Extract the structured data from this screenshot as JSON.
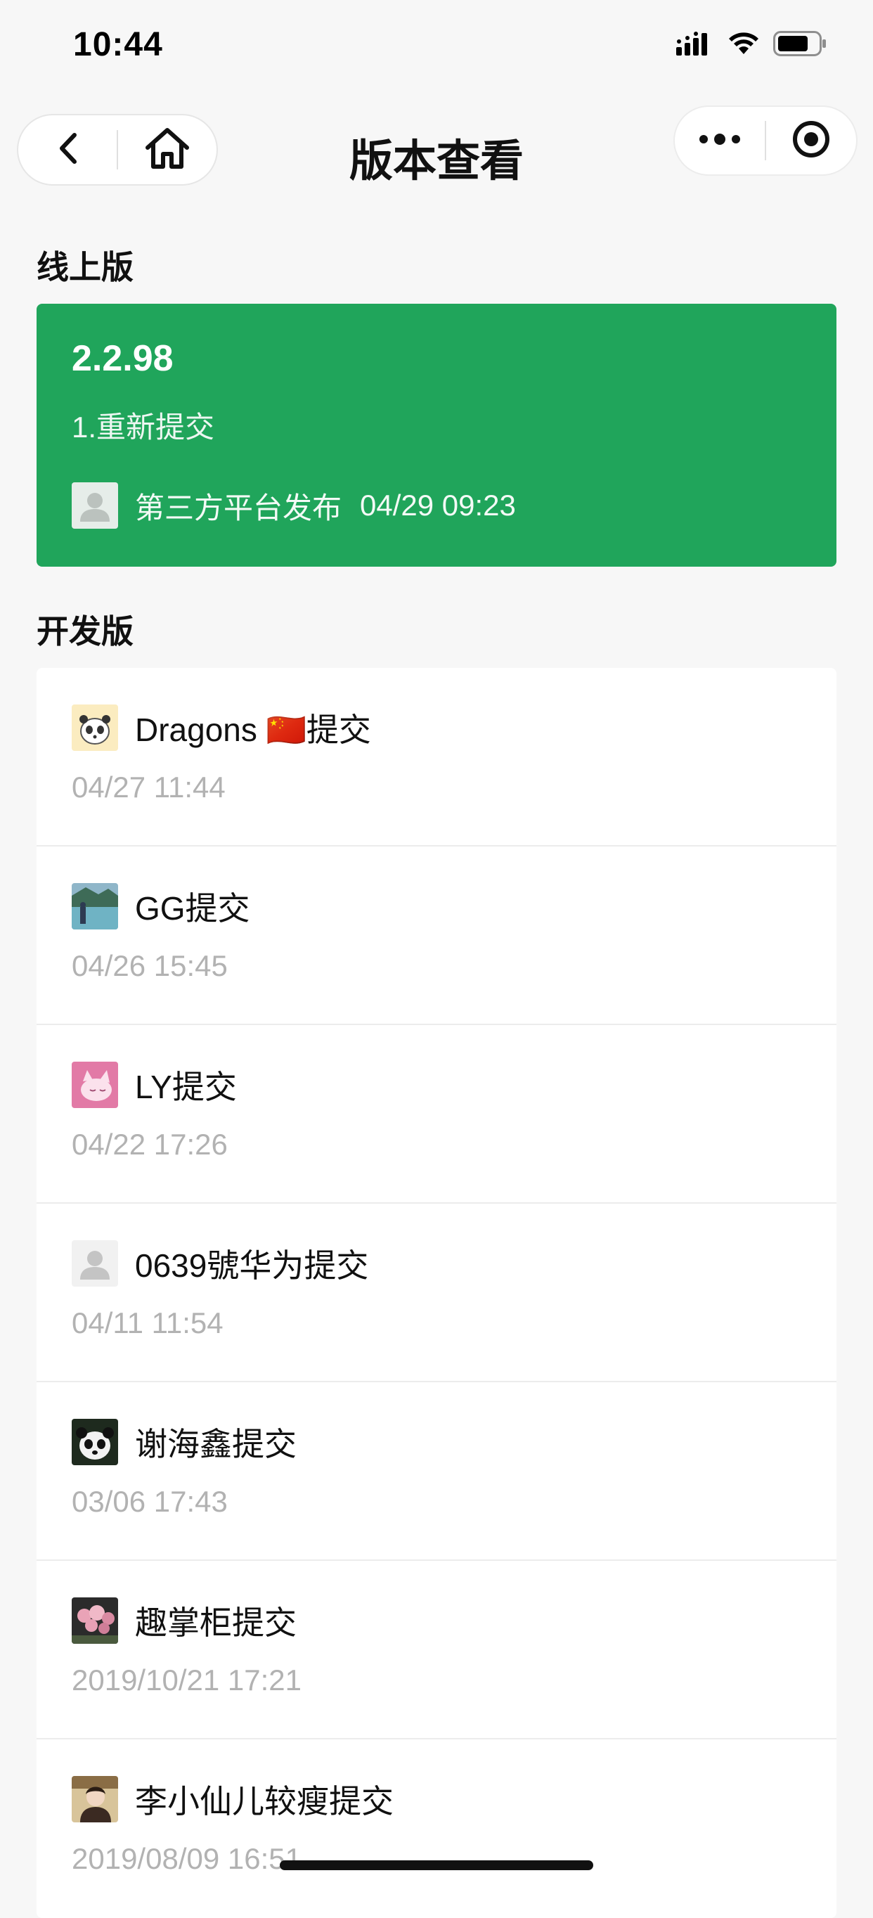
{
  "status_bar": {
    "time": "10:44",
    "icons": [
      "signal-icon",
      "wifi-icon",
      "battery-icon"
    ]
  },
  "nav": {
    "title": "版本查看",
    "left_capsule": [
      "back-icon",
      "home-icon"
    ],
    "right_capsule": [
      "more-icon",
      "target-icon"
    ]
  },
  "online": {
    "heading": "线上版",
    "version": "2.2.98",
    "desc": "1.重新提交",
    "publisher": "第三方平台发布",
    "datetime": "04/29 09:23",
    "card_color": "#20a55b"
  },
  "dev": {
    "heading": "开发版",
    "items": [
      {
        "name": "Dragons 🇨🇳提交",
        "time": "04/27 11:44",
        "avatar": "panda-cartoon-avatar"
      },
      {
        "name": "GG提交",
        "time": "04/26 15:45",
        "avatar": "lake-photo-avatar"
      },
      {
        "name": "LY提交",
        "time": "04/22 17:26",
        "avatar": "pink-cartoon-avatar"
      },
      {
        "name": "0639號华为提交",
        "time": "04/11 11:54",
        "avatar": "default-user-avatar"
      },
      {
        "name": "谢海鑫提交",
        "time": "03/06 17:43",
        "avatar": "panda-photo-avatar"
      },
      {
        "name": "趣掌柜提交",
        "time": "2019/10/21 17:21",
        "avatar": "flowers-photo-avatar"
      },
      {
        "name": "李小仙儿较瘦提交",
        "time": "2019/08/09 16:51",
        "avatar": "person-photo-avatar"
      }
    ]
  }
}
